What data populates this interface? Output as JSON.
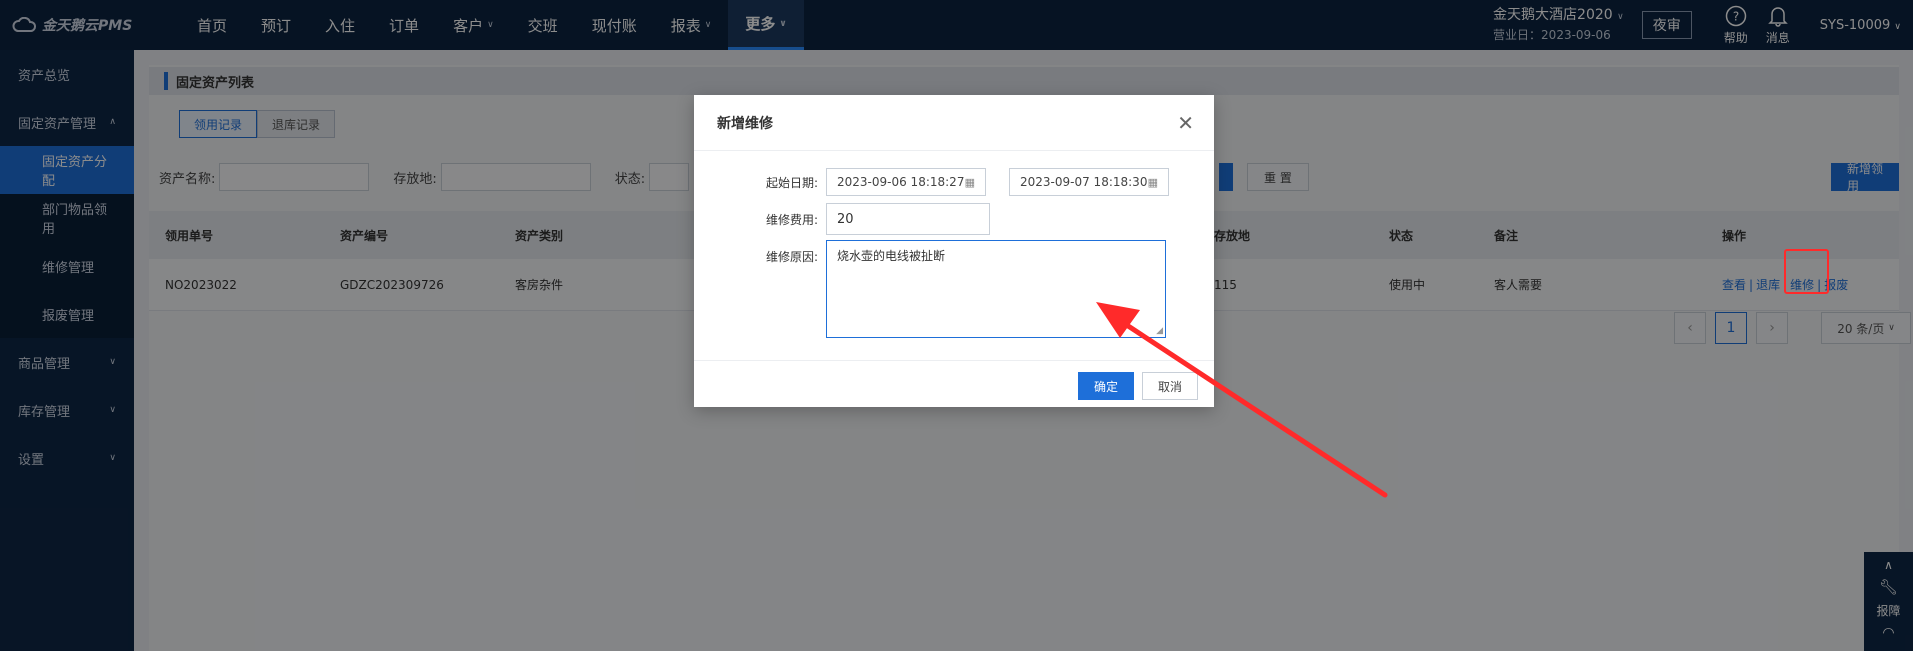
{
  "topbar": {
    "logo_text": "金天鹅云PMS",
    "nav": [
      {
        "label": "首页",
        "dropdown": false
      },
      {
        "label": "预订",
        "dropdown": false
      },
      {
        "label": "入住",
        "dropdown": false
      },
      {
        "label": "订单",
        "dropdown": false
      },
      {
        "label": "客户",
        "dropdown": true
      },
      {
        "label": "交班",
        "dropdown": false
      },
      {
        "label": "现付账",
        "dropdown": false
      },
      {
        "label": "报表",
        "dropdown": true
      },
      {
        "label": "更多",
        "dropdown": true
      }
    ],
    "hotel_name": "金天鹅大酒店2020",
    "business_day": "营业日：2023-09-06",
    "night_audit": "夜审",
    "help": "帮助",
    "messages": "消息",
    "user": "SYS-10009"
  },
  "sidebar": {
    "items": [
      {
        "label": "资产总览"
      },
      {
        "label": "固定资产管理"
      },
      {
        "label": "固定资产分配"
      },
      {
        "label": "部门物品领用"
      },
      {
        "label": "维修管理"
      },
      {
        "label": "报废管理"
      },
      {
        "label": "商品管理"
      },
      {
        "label": "库存管理"
      },
      {
        "label": "设置"
      }
    ]
  },
  "main": {
    "title": "固定资产列表",
    "tabs": [
      "领用记录",
      "退库记录"
    ],
    "filters": {
      "asset_name_label": "资产名称:",
      "location_label": "存放地:",
      "status_label": "状态:",
      "reset": "重 置",
      "new_button": "新增领用"
    },
    "table": {
      "headers": [
        "领用单号",
        "资产编号",
        "资产类别",
        "存放地",
        "状态",
        "备注",
        "操作"
      ],
      "rows": [
        {
          "order_no": "NO2023022",
          "asset_no": "GDZC202309726",
          "category": "客房杂件",
          "location": "115",
          "status": "使用中",
          "remark": "客人需要"
        }
      ],
      "actions": [
        "查看",
        "退库",
        "维修",
        "报废"
      ]
    },
    "pager": {
      "current": "1",
      "page_size": "20 条/页"
    }
  },
  "modal": {
    "title": "新增维修",
    "start_date_label": "起始日期:",
    "start_date": "2023-09-06 18:18:27",
    "end_date": "2023-09-07 18:18:30",
    "cost_label": "维修费用:",
    "cost": "20",
    "reason_label": "维修原因:",
    "reason": "烧水壶的电线被扯断",
    "ok": "确定",
    "cancel": "取消"
  },
  "float_tool": {
    "label": "报障"
  }
}
